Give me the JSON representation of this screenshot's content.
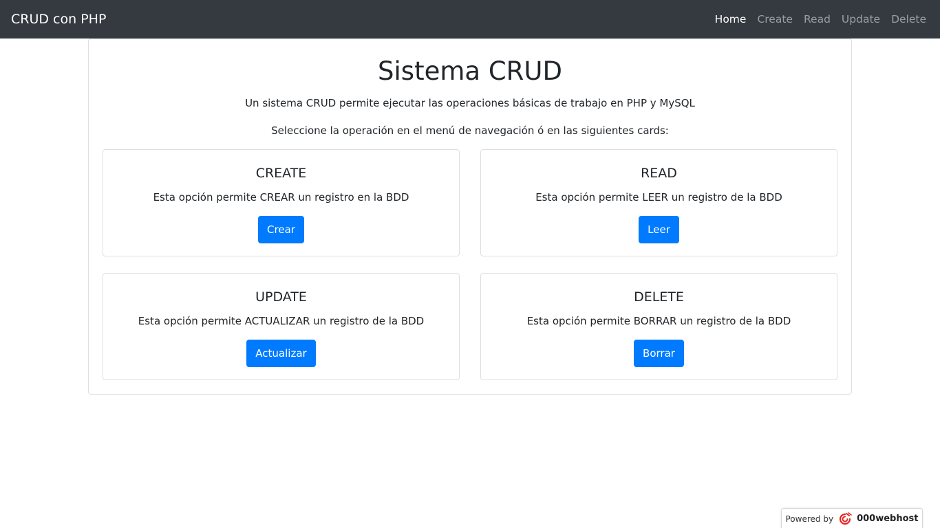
{
  "navbar": {
    "brand": "CRUD con PHP",
    "links": [
      {
        "label": "Home",
        "active": true
      },
      {
        "label": "Create",
        "active": false
      },
      {
        "label": "Read",
        "active": false
      },
      {
        "label": "Update",
        "active": false
      },
      {
        "label": "Delete",
        "active": false
      }
    ]
  },
  "main": {
    "title": "Sistema CRUD",
    "lead1": "Un sistema CRUD permite ejecutar las operaciones básicas de trabajo en PHP y MySQL",
    "lead2": "Seleccione la operación en el menú de navegación ó en las siguientes cards:",
    "cards": [
      {
        "title": "CREATE",
        "text": "Esta opción permite CREAR un registro en la BDD",
        "button": "Crear"
      },
      {
        "title": "READ",
        "text": "Esta opción permite LEER un registro de la BDD",
        "button": "Leer"
      },
      {
        "title": "UPDATE",
        "text": "Esta opción permite ACTUALIZAR un registro de la BDD",
        "button": "Actualizar"
      },
      {
        "title": "DELETE",
        "text": "Esta opción permite BORRAR un registro de la BDD",
        "button": "Borrar"
      }
    ]
  },
  "footer_badge": {
    "prefix": "Powered by",
    "host": "000webhost",
    "icon": "000webhost-logo-icon"
  },
  "colors": {
    "navbar_bg": "#343a40",
    "primary": "#007bff",
    "logo_red": "#e5261f"
  }
}
